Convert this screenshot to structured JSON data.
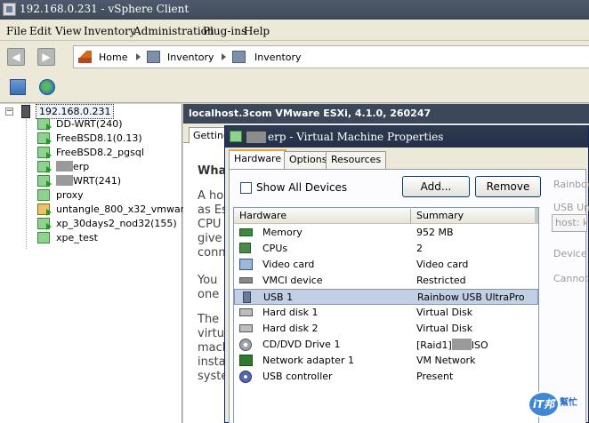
{
  "window": {
    "title": "192.168.0.231 - vSphere Client"
  },
  "menu": [
    "File",
    "Edit",
    "View",
    "Inventory",
    "Administration",
    "Plug-ins",
    "Help"
  ],
  "breadcrumb": {
    "home": "Home",
    "inventory1": "Inventory",
    "inventory2": "Inventory"
  },
  "tree": {
    "host": "192.168.0.231",
    "items": [
      {
        "prefix": "DD-WRT(240)",
        "suffix": ""
      },
      {
        "prefix": "FreeBSD8.1(0.13)",
        "suffix": ""
      },
      {
        "prefix": "FreeBSD8.2_pgsql",
        "suffix": ""
      },
      {
        "prefix": "",
        "suffix": "erp"
      },
      {
        "prefix": "",
        "suffix": "WRT(241)"
      },
      {
        "prefix": "proxy",
        "suffix": ""
      },
      {
        "prefix": "untangle_800_x32_vmware",
        "suffix": ""
      },
      {
        "prefix": "xp_30days2_nod32(155)",
        "suffix": ""
      },
      {
        "prefix": "xpe_test",
        "suffix": ""
      }
    ]
  },
  "detail": {
    "header": "localhost.3com VMware ESXi, 4.1.0, 260247",
    "tab": "Getting Started",
    "heading": "What",
    "para1": [
      "A ho",
      "as Es",
      "CPU",
      "give",
      "conn"
    ],
    "para2": [
      "You",
      "one"
    ],
    "para3": [
      "The",
      "virtu",
      "mach",
      "insta",
      "syste"
    ]
  },
  "dialog": {
    "title": "erp - Virtual Machine Properties",
    "tabs": [
      "Hardware",
      "Options",
      "Resources"
    ],
    "show_all_label": "Show All Devices",
    "add_button": "Add...",
    "remove_button": "Remove",
    "columns": [
      "Hardware",
      "Summary"
    ],
    "hardware": [
      {
        "name": "Memory",
        "summary": "952 MB",
        "icon": "memory-icon"
      },
      {
        "name": "CPUs",
        "summary": "2",
        "icon": "cpu-icon"
      },
      {
        "name": "Video card",
        "summary": "Video card",
        "icon": "video-card-icon"
      },
      {
        "name": "VMCI device",
        "summary": "Restricted",
        "icon": "vmci-icon"
      },
      {
        "name": "USB 1",
        "summary": "Rainbow USB UltraPro",
        "icon": "usb-icon"
      },
      {
        "name": "Hard disk 1",
        "summary": "Virtual Disk",
        "icon": "hard-disk-icon"
      },
      {
        "name": "Hard disk 2",
        "summary": "Virtual Disk",
        "icon": "hard-disk-icon"
      },
      {
        "name": "CD/DVD Drive 1",
        "summary_prefix": "[Raid1]",
        "summary_suffix": "ISO",
        "icon": "cd-dvd-icon"
      },
      {
        "name": "Network adapter 1",
        "summary": "VM Network",
        "icon": "network-adapter-icon"
      },
      {
        "name": "USB controller",
        "summary": "Present",
        "icon": "usb-controller-icon"
      }
    ],
    "side": {
      "device_name": "Rainbow",
      "usb_unico": "USB Unic",
      "host_box": "host: k",
      "device_status": "Device S",
      "cannot": "Cannot r"
    }
  },
  "watermark": {
    "badge": "iT邦",
    "text": "幫忙"
  }
}
